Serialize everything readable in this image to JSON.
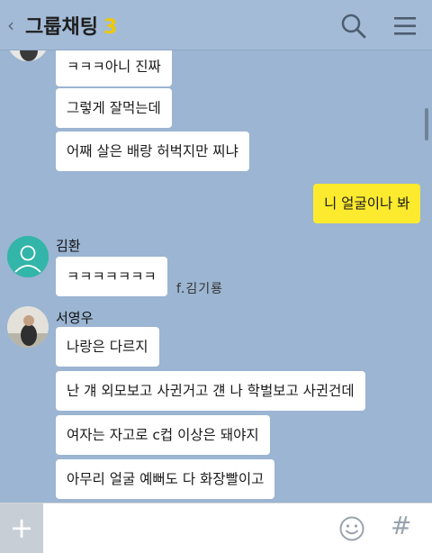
{
  "header": {
    "title": "그룹채팅",
    "member_count": "3"
  },
  "messages": {
    "m1": "ㅋㅋㅋ아니 진짜",
    "m2": "그렇게 잘먹는데",
    "m3": "어째 살은 배랑 허벅지만 찌냐",
    "m4": "니 얼굴이나 봐",
    "m5": "ㅋㅋㅋㅋㅋㅋㅋ",
    "m6": "나랑은 다르지",
    "m7": "난 걔 외모보고 사귄거고 걘 나 학벌보고 사귄건데",
    "m8": "여자는 자고로 c컵 이상은 돼야지",
    "m9": "아무리 얼굴 예뻐도 다 화장빨이고"
  },
  "senders": {
    "s1": "김환",
    "s2": "서영우"
  },
  "watermark": "f.김기룡",
  "input": {
    "placeholder": ""
  },
  "icons": {
    "back": "chevron-left-icon",
    "search": "search-icon",
    "menu": "menu-icon",
    "plus": "plus-icon",
    "emoji": "smiley-icon",
    "hash": "hash-icon"
  },
  "colors": {
    "background": "#9bb5d2",
    "my_bubble": "#fcea2e",
    "other_bubble": "#ffffff",
    "member_count": "#f0c800"
  }
}
